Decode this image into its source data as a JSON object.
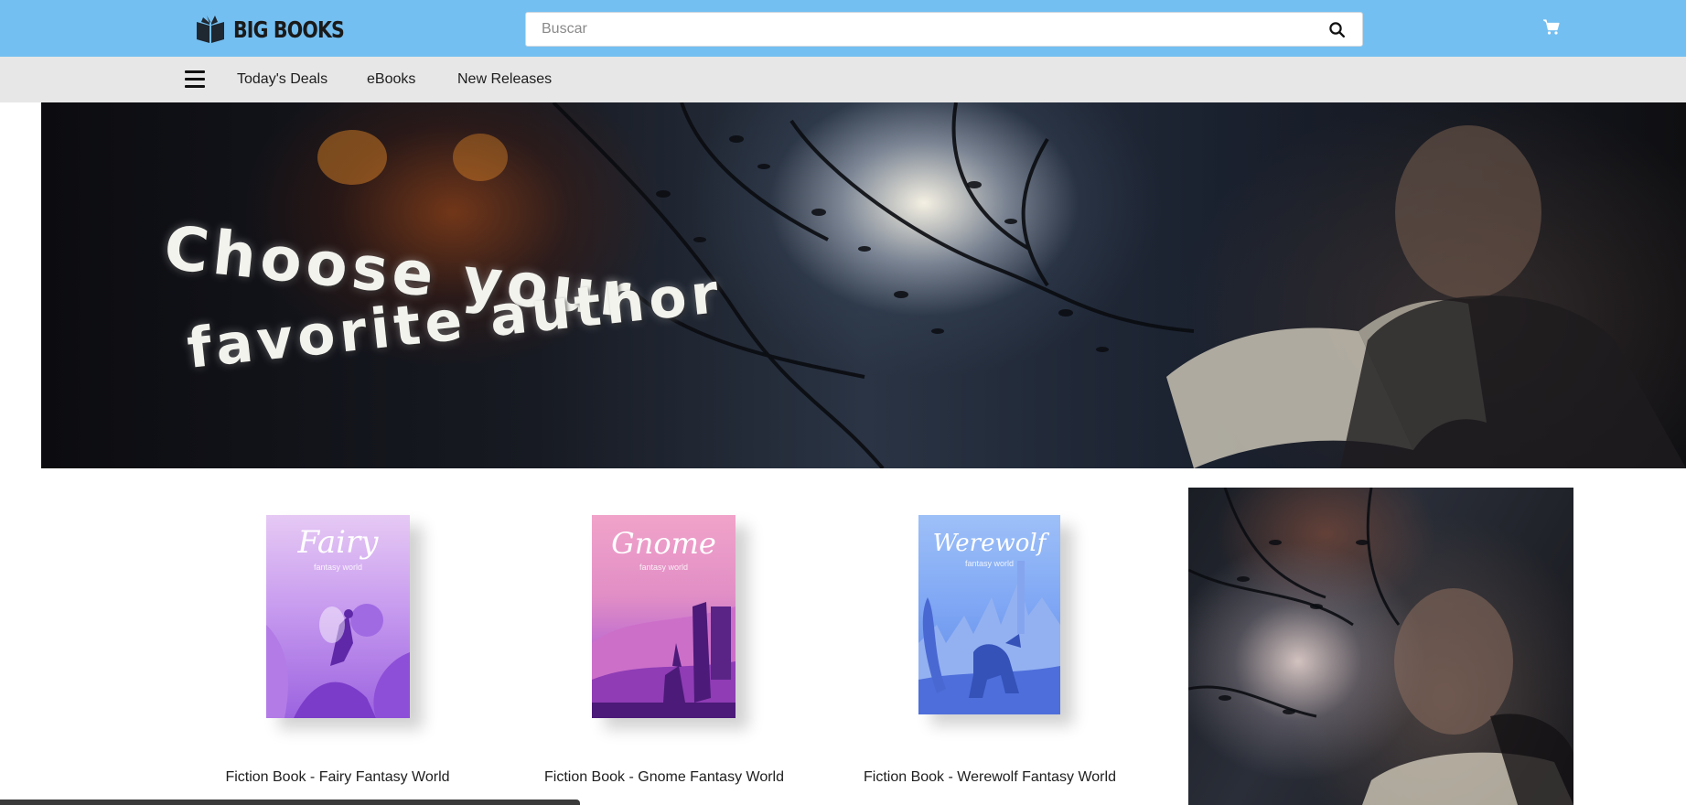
{
  "header": {
    "logo_text": "BIG BOOKS",
    "logo_icon": "book-icon",
    "search_placeholder": "Buscar",
    "search_icon": "search-icon",
    "cart_icon": "cart-icon",
    "background_color": "#74bff1"
  },
  "nav": {
    "menu_icon": "hamburger-menu-icon",
    "links": [
      "Today's Deals",
      "eBooks",
      "New Releases"
    ],
    "background_color": "#e7e7e7"
  },
  "hero": {
    "line1": "Choose your",
    "line2": "favorite author"
  },
  "products": [
    {
      "cover_title": "Fairy",
      "cover_subtitle": "fantasy world",
      "label": "Fiction Book - Fairy Fantasy World"
    },
    {
      "cover_title": "Gnome",
      "cover_subtitle": "fantasy world",
      "label": "Fiction Book - Gnome Fantasy World"
    },
    {
      "cover_title": "Werewolf",
      "cover_subtitle": "fantasy world",
      "label": "Fiction Book - Werewolf Fantasy World"
    }
  ]
}
